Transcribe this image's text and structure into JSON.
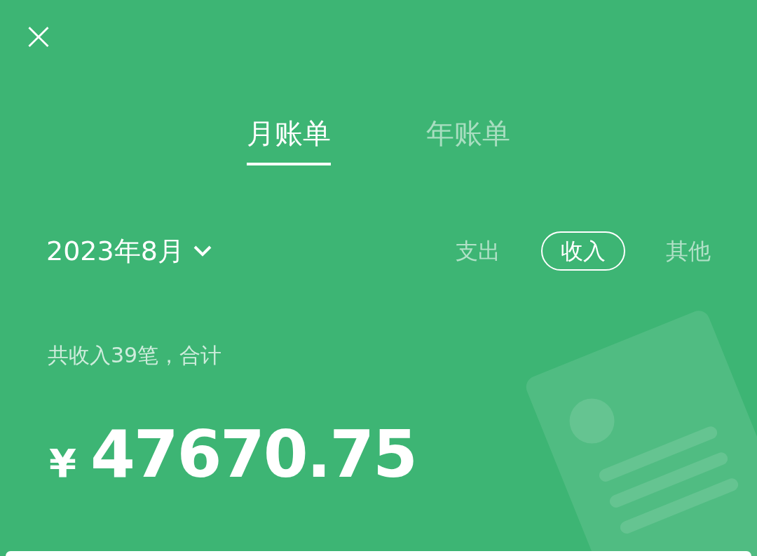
{
  "close_button": {
    "label": "×"
  },
  "tabs": [
    {
      "label": "月账单",
      "selected": true
    },
    {
      "label": "年账单",
      "selected": false
    }
  ],
  "period": {
    "label": "2023年8月"
  },
  "filters": [
    {
      "label": "支出",
      "selected": false
    },
    {
      "label": "收入",
      "selected": true
    },
    {
      "label": "其他",
      "selected": false
    }
  ],
  "summary": {
    "text": "共收入39笔，合计",
    "currency": "¥",
    "amount": "47670.75"
  }
}
